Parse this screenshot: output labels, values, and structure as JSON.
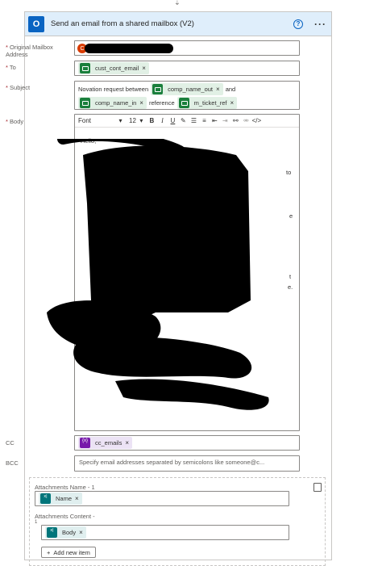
{
  "header": {
    "title": "Send an email from a shared mailbox (V2)",
    "help": "?",
    "more": "···"
  },
  "fields": {
    "mailbox_label": "Original Mailbox Address",
    "mailbox_avatar_initial": "C",
    "to_label": "To",
    "to_token": "cust_cont_email",
    "subject_label": "Subject",
    "subject_text_1": "Novation request between",
    "subject_token_1": "comp_name_out",
    "subject_text_2": "and",
    "subject_token_2": "comp_name_in",
    "subject_text_3": "reference",
    "subject_token_3": "m_ticket_ref",
    "body_label": "Body",
    "cc_label": "CC",
    "cc_token": "cc_emails",
    "bcc_label": "BCC",
    "bcc_placeholder": "Specify email addresses separated by semicolons like someone@c..."
  },
  "editor": {
    "font": "Font",
    "size": "12",
    "greeting": "Hello,",
    "stray_1": "to",
    "stray_2": "e",
    "stray_3": "t",
    "stray_4": "e."
  },
  "attachments": {
    "name_label": "Attachments Name - 1",
    "name_token": "Name",
    "content_label": "Attachments Content -",
    "content_sub": "1",
    "content_token": "Body",
    "add_label": "Add new item"
  },
  "colors": {
    "header_bg": "#dfeefb",
    "outlook_blue": "#0a64c2",
    "dynamic_green": "#1a7f3c",
    "variable_purple": "#7719aa",
    "teal": "#00757a"
  }
}
